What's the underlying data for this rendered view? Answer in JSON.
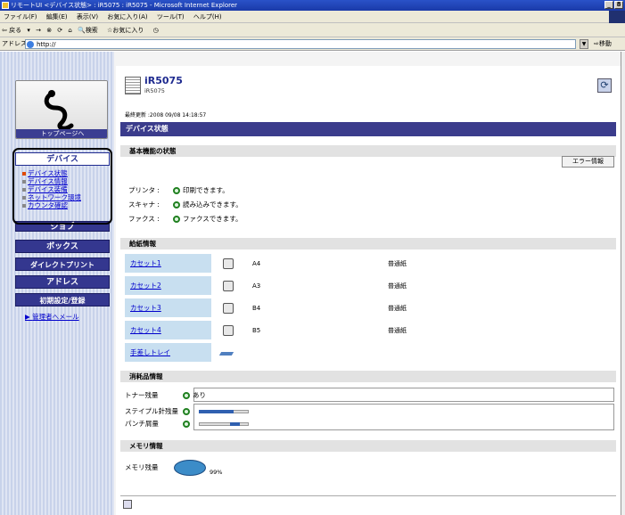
{
  "window": {
    "title": "リモートUI <デバイス状態> : iR5075 : iR5075 - Microsoft Internet Explorer",
    "buttons": [
      "_",
      "8"
    ]
  },
  "menubar": [
    "ファイル(F)",
    "編集(E)",
    "表示(V)",
    "お気に入り(A)",
    "ツール(T)",
    "ヘルプ(H)"
  ],
  "toolbar": {
    "back": "戻る",
    "forward": "→",
    "search": "検索",
    "favorites": "お気に入り"
  },
  "address": {
    "label": "アドレス(D)",
    "url": "http://",
    "go": "移動"
  },
  "nav": {
    "logo_caption": "トップページへ",
    "device": "デバイス",
    "sub_items": [
      "デバイス状態",
      "デバイス情報",
      "デバイス装備",
      "ネットワーク環境",
      "カウンタ確認"
    ],
    "job": "ジョブ",
    "box": "ボックス",
    "direct_print": "ダイレクトプリント",
    "address": "アドレス",
    "settings": "初期設定/登録",
    "admin_mail": "管理者へメール"
  },
  "device": {
    "name": "iR5075",
    "model": "iR5075",
    "last_updated": "最終更新 :2008 09/08 14:18:57"
  },
  "section_title": "デバイス状態",
  "basic": {
    "header": "基本機能の状態",
    "error_button": "エラー情報",
    "rows": [
      {
        "label": "プリンタ :",
        "status": "印刷できます。"
      },
      {
        "label": "スキャナ :",
        "status": "読み込みできます。"
      },
      {
        "label": "ファクス :",
        "status": "ファクスできます。"
      }
    ]
  },
  "paper": {
    "header": "給紙情報",
    "rows": [
      {
        "source": "カセット1",
        "size": "A4",
        "type": "普通紙"
      },
      {
        "source": "カセット2",
        "size": "A3",
        "type": "普通紙"
      },
      {
        "source": "カセット3",
        "size": "B4",
        "type": "普通紙"
      },
      {
        "source": "カセット4",
        "size": "B5",
        "type": "普通紙"
      },
      {
        "source": "手差しトレイ",
        "size": "",
        "type": ""
      }
    ]
  },
  "consumables": {
    "header": "消耗品情報",
    "toner_label": "トナー残量",
    "toner_value": "あり",
    "staple_label": "ステイプル針残量",
    "staple_level": 0.7,
    "punch_label": "パンチ屑量",
    "punch_level": 0.2
  },
  "memory": {
    "header": "メモリ情報",
    "label": "メモリ残量",
    "value": "99%"
  },
  "colors": {
    "nav_blue": "#34378f",
    "section_purple": "#3b3c8c",
    "status_green": "#208020",
    "paper_cell": "#c8dff0"
  }
}
